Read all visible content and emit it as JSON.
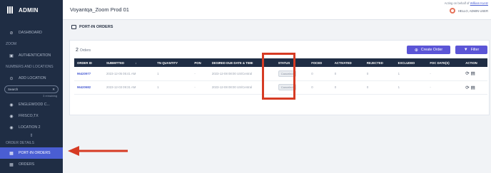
{
  "sidebar": {
    "brand": "ADMIN",
    "items": [
      {
        "label": "DASHBOARD",
        "icon": "dashboard-icon",
        "glyph": "⊘"
      },
      {
        "label": "ZOOM",
        "section": true
      },
      {
        "label": "AUTHENTICATION",
        "icon": "authentication-icon",
        "glyph": "▣"
      },
      {
        "label": "NUMBERS AND LOCATIONS",
        "section": true
      },
      {
        "label": "ADD LOCATION",
        "icon": "add-location-icon",
        "glyph": "⊙"
      }
    ],
    "search": {
      "placeholder": "Search",
      "hint": "3 remaining"
    },
    "locations": [
      {
        "label": "ENGLEWOOD C...",
        "glyph": "◉"
      },
      {
        "label": "FRISCO,TX",
        "glyph": "◉"
      },
      {
        "label": "LOCATION 2",
        "glyph": "◉"
      }
    ],
    "order_section": "ORDER DETAILS",
    "port_in": {
      "label": "PORT-IN ORDERS",
      "glyph": "▦"
    },
    "orders": {
      "label": "ORDERS",
      "glyph": "▦"
    }
  },
  "header": {
    "title": "Voyantqa_Zoom Prod 01",
    "acting_prefix": "Acting on behalf of",
    "acting_user": "William Kuntz",
    "user_label": "HELLO, ADMIN USER"
  },
  "page": {
    "title": "PORT-IN ORDERS"
  },
  "panel": {
    "count": "2",
    "count_label": "Orders",
    "create_button": "Create Order",
    "filter_button": "Filter"
  },
  "table": {
    "columns": [
      "ORDER ID",
      "SUBMITTED",
      "TN QUANTITY",
      "PON",
      "DESIRED DUE DATE & TIME",
      "STATUS",
      "FOCED",
      "ACTIVATED",
      "REJECTED",
      "EXCLUDED",
      "FOC DATE(S)",
      "ACTION"
    ],
    "rows": [
      {
        "order_id": "96420977",
        "submitted": "2023-12-05 05:41 AM",
        "tn_quantity": "1",
        "pon": "-",
        "desired": "2023-12-08 08:00 US/Central",
        "status": "Canceled",
        "foced": "0",
        "activated": "0",
        "rejected": "0",
        "excluded": "1",
        "foc_dates": "-"
      },
      {
        "order_id": "96420682",
        "submitted": "2023-12-03 09:31 AM",
        "tn_quantity": "1",
        "pon": "-",
        "desired": "2023-12-08 08:00 US/Central",
        "status": "Canceled",
        "foced": "0",
        "activated": "0",
        "rejected": "0",
        "excluded": "1",
        "foc_dates": "-"
      }
    ]
  },
  "colors": {
    "sidebar": "#1f2d44",
    "accent": "#5b55d6",
    "annotation": "#d63b24"
  }
}
